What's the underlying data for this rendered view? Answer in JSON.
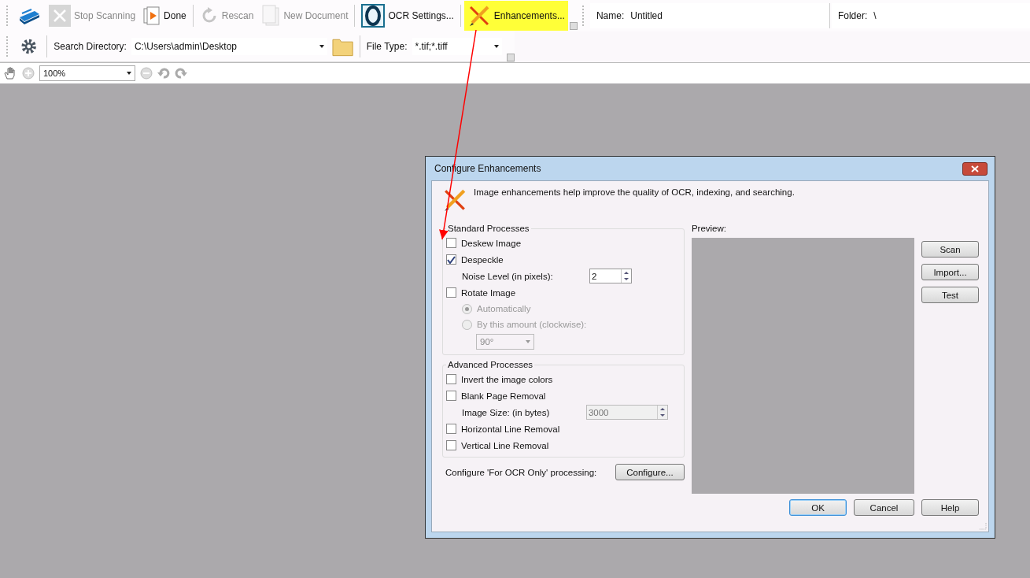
{
  "toolbar": {
    "buttons": [
      {
        "kind": "scanner",
        "disabled": false,
        "highlighted": false
      },
      {
        "kind": "stop",
        "label": "Stop Scanning",
        "disabled": true,
        "highlighted": false
      },
      {
        "kind": "done",
        "label": "Done",
        "disabled": false,
        "highlighted": false
      },
      {
        "kind": "rescan",
        "label": "Rescan",
        "disabled": true,
        "highlighted": false
      },
      {
        "kind": "new-document",
        "label": "New Document",
        "disabled": true,
        "highlighted": false
      },
      {
        "kind": "ocr",
        "label": "OCR Settings...",
        "disabled": false,
        "highlighted": false
      },
      {
        "kind": "enhancements",
        "label": "Enhancements...",
        "disabled": false,
        "highlighted": true
      }
    ],
    "fields": [
      {
        "label": "Name:",
        "value": "Untitled"
      },
      {
        "label": "Folder:",
        "value": "\\"
      }
    ]
  },
  "search_bar": {
    "directory_label": "Search Directory:",
    "directory": "C:\\Users\\admin\\Desktop",
    "file_type_label": "File Type:",
    "file_type": "*.tif;*.tiff"
  },
  "viewer": {
    "zoom": "100%"
  },
  "dialog": {
    "title": "Configure Enhancements",
    "description": "Image enhancements help improve the quality of OCR, indexing, and searching.",
    "groups": [
      {
        "title": "Standard Processes",
        "items": [
          {
            "kind": "checkbox",
            "label": "Deskew Image",
            "checked": false,
            "disabled": false
          },
          {
            "kind": "checkbox",
            "label": "Despeckle",
            "checked": true,
            "disabled": false
          },
          {
            "kind": "spin",
            "label": "Noise Level (in pixels):",
            "value": "2",
            "disabled": false
          },
          {
            "kind": "checkbox",
            "label": "Rotate Image",
            "checked": false,
            "disabled": false
          },
          {
            "kind": "radio",
            "label": "Automatically",
            "selected": true,
            "disabled": true
          },
          {
            "kind": "radio",
            "label": "By this amount (clockwise):",
            "selected": false,
            "disabled": true
          },
          {
            "kind": "dropdown",
            "value": "90°",
            "disabled": true
          }
        ]
      },
      {
        "title": "Advanced Processes",
        "items": [
          {
            "kind": "checkbox",
            "label": "Invert the image colors",
            "checked": false,
            "disabled": false
          },
          {
            "kind": "checkbox",
            "label": "Blank Page Removal",
            "checked": false,
            "disabled": false
          },
          {
            "kind": "spin",
            "label": "Image Size: (in bytes)",
            "value": "3000",
            "disabled": true
          },
          {
            "kind": "checkbox",
            "label": "Horizontal Line Removal",
            "checked": false,
            "disabled": false
          },
          {
            "kind": "checkbox",
            "label": "Vertical Line Removal",
            "checked": false,
            "disabled": false
          }
        ]
      }
    ],
    "configure_label": "Configure 'For OCR Only' processing:",
    "configure_button": "Configure...",
    "preview_label": "Preview:",
    "side_buttons": [
      "Scan",
      "Import...",
      "Test"
    ],
    "footer_buttons": [
      {
        "label": "OK",
        "default": true
      },
      {
        "label": "Cancel",
        "default": false
      },
      {
        "label": "Help",
        "default": false
      }
    ]
  }
}
